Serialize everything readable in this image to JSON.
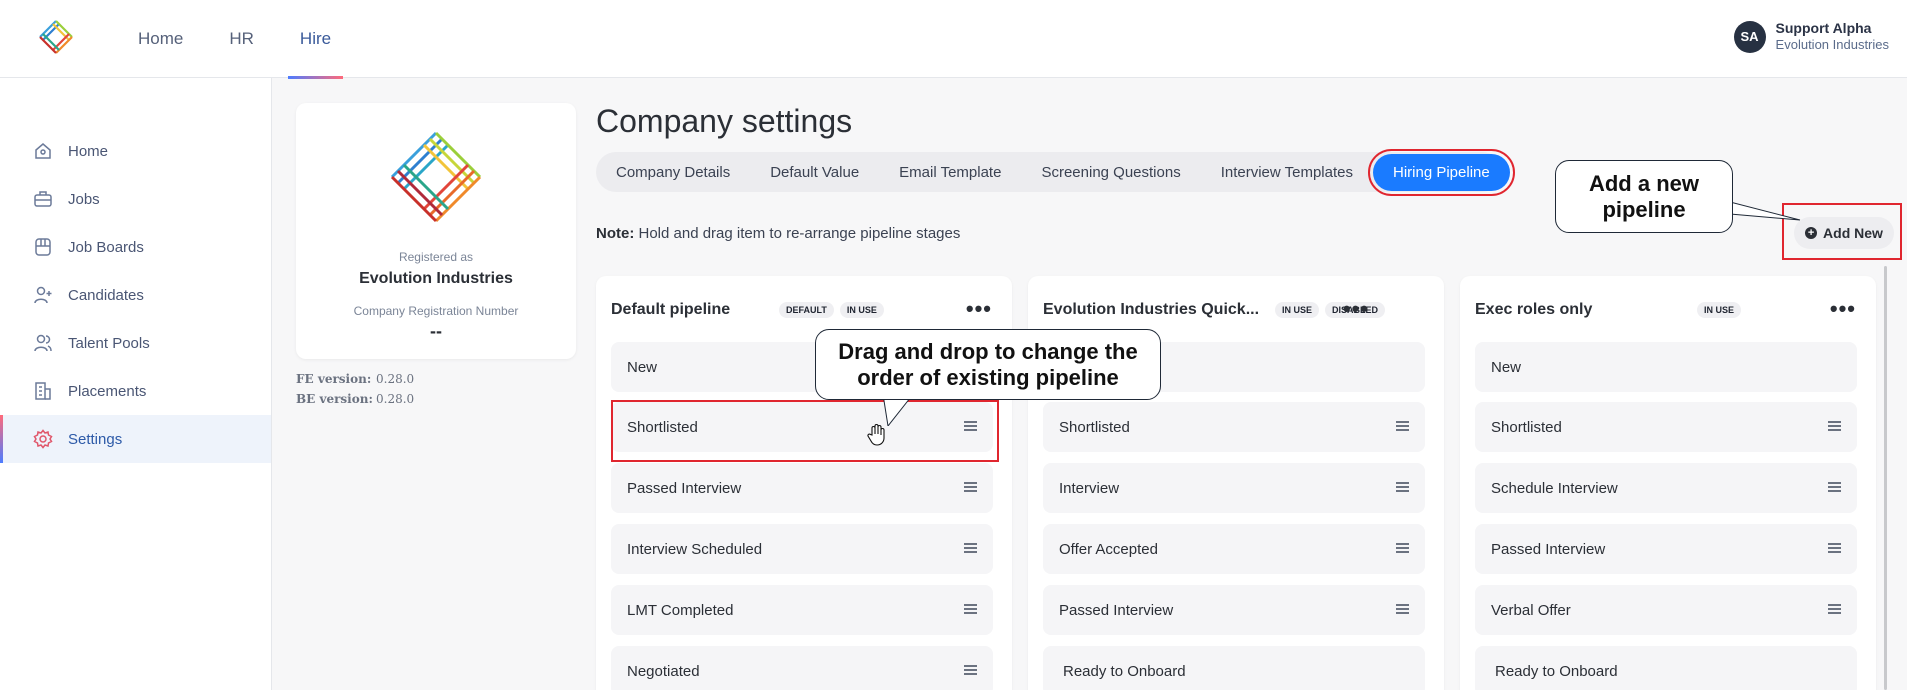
{
  "topnav": {
    "items": [
      "Home",
      "HR",
      "Hire"
    ],
    "active": "Hire"
  },
  "user": {
    "initials": "SA",
    "name": "Support Alpha",
    "company": "Evolution Industries"
  },
  "sidebar": {
    "items": [
      {
        "label": "Home",
        "icon": "home-icon"
      },
      {
        "label": "Jobs",
        "icon": "briefcase-icon"
      },
      {
        "label": "Job Boards",
        "icon": "board-icon"
      },
      {
        "label": "Candidates",
        "icon": "add-user-icon"
      },
      {
        "label": "Talent Pools",
        "icon": "users-icon"
      },
      {
        "label": "Placements",
        "icon": "building-icon"
      },
      {
        "label": "Settings",
        "icon": "gear-icon"
      }
    ],
    "active": "Settings"
  },
  "company": {
    "registered_as_label": "Registered as",
    "name": "Evolution Industries",
    "reg_number_label": "Company Registration Number",
    "reg_number": "--"
  },
  "versions": {
    "fe_label": "FE version:",
    "fe": "0.28.0",
    "be_label": "BE version:",
    "be": "0.28.0"
  },
  "page": {
    "title": "Company settings"
  },
  "tabs": [
    "Company Details",
    "Default Value",
    "Email Template",
    "Screening Questions",
    "Interview Templates",
    "Hiring Pipeline"
  ],
  "active_tab": "Hiring Pipeline",
  "note": {
    "label": "Note:",
    "text": " Hold and drag item to re-arrange pipeline stages"
  },
  "add_new_label": "Add New",
  "pipelines": [
    {
      "name": "Default pipeline",
      "badges": [
        "DEFAULT",
        "IN USE"
      ],
      "stages": [
        "New",
        "Shortlisted",
        "Passed Interview",
        "Interview Scheduled",
        "LMT Completed",
        "Negotiated"
      ]
    },
    {
      "name": "Evolution Industries Quick...",
      "badges": [
        "IN USE",
        "DISABLED"
      ],
      "stages": [
        "",
        "Shortlisted",
        "Interview",
        "Offer Accepted",
        "Passed Interview",
        "Ready to Onboard"
      ]
    },
    {
      "name": "Exec roles only",
      "badges": [
        "IN USE"
      ],
      "stages": [
        "New",
        "Shortlisted",
        "Schedule Interview",
        "Passed Interview",
        "Verbal Offer",
        "Ready to Onboard"
      ]
    }
  ],
  "callouts": {
    "drag": "Drag and drop to change the order of existing pipeline",
    "add": "Add a new pipeline"
  },
  "colors": {
    "accent": "#1a7bff",
    "highlight": "#e0262f"
  }
}
